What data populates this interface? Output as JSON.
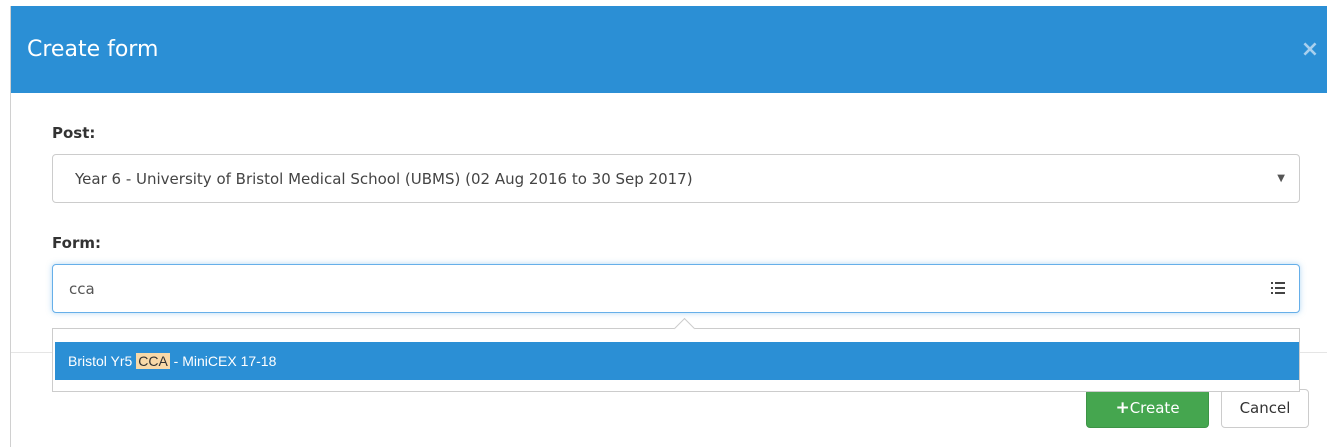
{
  "modal": {
    "title": "Create form",
    "close_label": "×"
  },
  "post": {
    "label": "Post:",
    "selected": "Year 6 - University of Bristol Medical School (UBMS) (02 Aug 2016 to 30 Sep 2017)",
    "caret": "▼"
  },
  "form": {
    "label": "Form:",
    "value": "cca",
    "icon": "list-icon"
  },
  "dropdown": {
    "items": [
      {
        "prefix": "Bristol Yr5 ",
        "match": "CCA",
        "suffix": " - MiniCEX 17-18"
      }
    ]
  },
  "footer": {
    "create_icon": "+",
    "create_label": "Create",
    "cancel_label": "Cancel"
  },
  "colors": {
    "header": "#2b8fd5",
    "create_button": "#45a64f",
    "highlight": "#f8d9a8"
  }
}
